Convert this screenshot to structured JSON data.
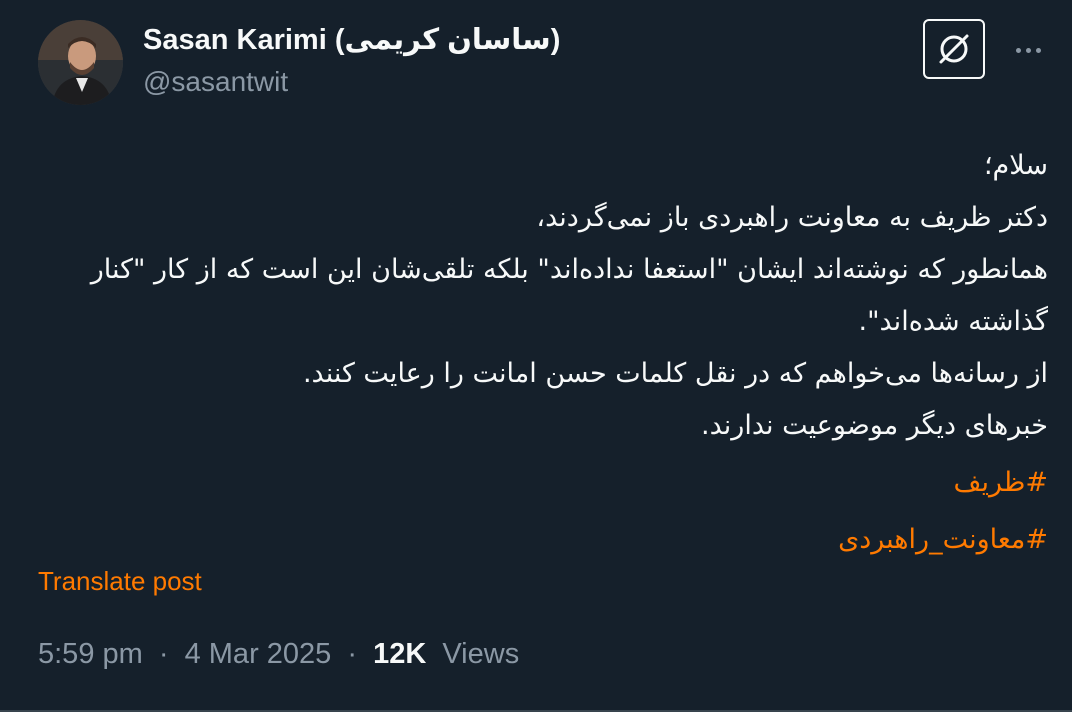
{
  "author": {
    "display_name": "Sasan Karimi (ساسان کریمی)",
    "handle": "@sasantwit"
  },
  "icons": {
    "avatar": "profile-photo",
    "grok": "grok-icon",
    "more": "more-options-icon"
  },
  "post": {
    "lines": [
      "سلام؛",
      "دکتر ظریف به معاونت راهبردی باز نمی‌گردند،",
      "همانطور که نوشته‌اند ایشان \"استعفا نداده‌اند\" بلکه تلقی‌شان این است که از کار \"کنار گذاشته شده‌اند\".",
      "از رسانه‌ها می‌خواهم که در نقل کلمات حسن امانت را رعایت کنند.",
      "خبرهای دیگر موضوعیت ندارند."
    ],
    "hashtags": [
      "#ظریف",
      "#معاونت_راهبردی"
    ]
  },
  "translate_label": "Translate post",
  "meta": {
    "time": "5:59 pm",
    "date": "4 Mar 2025",
    "separator": "·",
    "views_count": "12K",
    "views_label": "Views"
  },
  "colors": {
    "background": "#15202b",
    "accent": "#ff7a00",
    "text_primary": "#f7f9f9",
    "text_secondary": "#8b98a5"
  }
}
